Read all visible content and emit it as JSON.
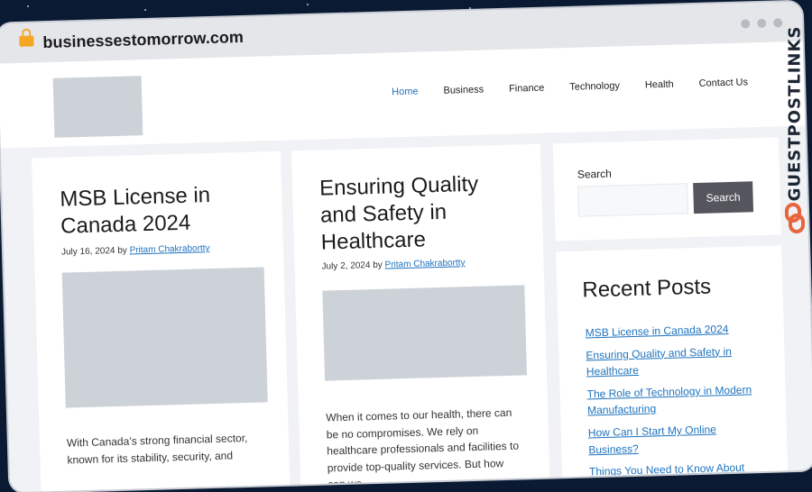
{
  "browser": {
    "url": "businessestomorrow.com"
  },
  "watermark": {
    "text": "GUESTPOSTLINKS"
  },
  "nav": {
    "items": [
      "Home",
      "Business",
      "Finance",
      "Technology",
      "Health",
      "Contact Us"
    ]
  },
  "posts": [
    {
      "title": "MSB License in Canada 2024",
      "date": "July 16, 2024",
      "by": "by",
      "author": "Pritam Chakrabortty",
      "excerpt": "With Canada’s strong financial sector, known for its stability, security, and"
    },
    {
      "title": "Ensuring Quality and Safety in Healthcare",
      "date": "July 2, 2024",
      "by": "by",
      "author": "Pritam Chakrabortty",
      "excerpt": "When it comes to our health, there can be no compromises. We rely on healthcare professionals and facilities to provide top-quality services. But how can we"
    }
  ],
  "search": {
    "label": "Search",
    "button": "Search",
    "placeholder": ""
  },
  "recent": {
    "title": "Recent Posts",
    "items": [
      "MSB License in Canada 2024",
      "Ensuring Quality and Safety in Healthcare",
      "The Role of Technology in Modern Manufacturing",
      "How Can I Start My Online Business?",
      "Things You Need to Know About"
    ]
  },
  "colors": {
    "accent": "#1e73be",
    "button": "#55555e",
    "watermark_icon": "#e8643c"
  }
}
